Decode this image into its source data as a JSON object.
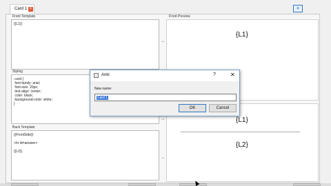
{
  "tab": {
    "label": "Card 1",
    "close_icon": "close-icon"
  },
  "toolbar": {
    "add_label": "+"
  },
  "sections": {
    "front_template": "Front Template",
    "styling": "Styling",
    "back_template": "Back Template",
    "front_preview": "Front Preview"
  },
  "editors": {
    "front": "{{L1}}",
    "styling": ".card {\n font-family: arial;\n font-size: 20px;\n text-align: center;\n color: black;\n background-color: white;\n}",
    "back": "{{FrontSide}}\n\n<hr id=answer>\n\n{{L2}}"
  },
  "arrows": {
    "a1": "→",
    "a2": "→",
    "a3": "→"
  },
  "preview": {
    "front": "{L1}",
    "back_top": "{L1}",
    "back_bottom": "{L2}"
  },
  "dialog": {
    "title": "Anki",
    "help": "?",
    "close": "✕",
    "label": "New name:",
    "input_value": "Card 1",
    "ok": "OK",
    "cancel": "Cancel"
  }
}
